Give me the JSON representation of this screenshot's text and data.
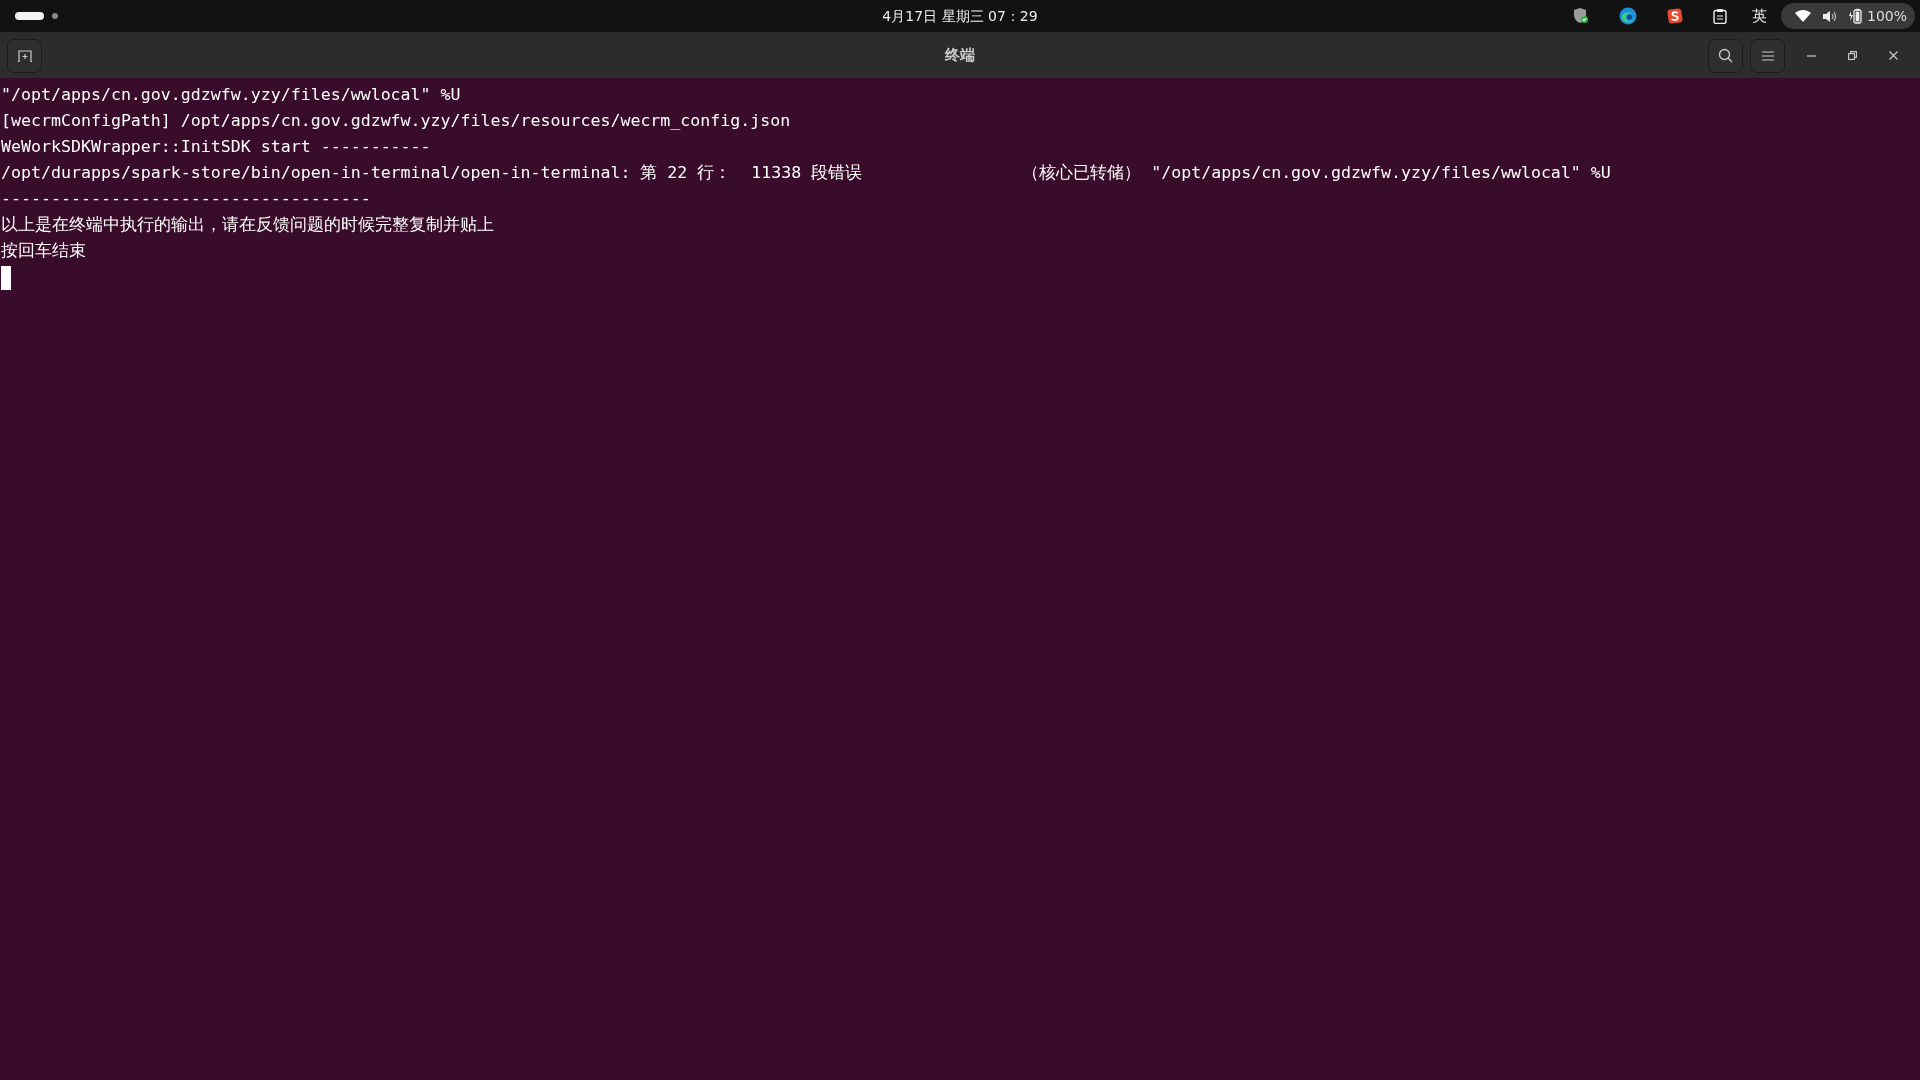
{
  "top_bar": {
    "clock": "4月17日 星期三 07：29",
    "input_method": "英",
    "battery": "100%"
  },
  "window": {
    "title": "终端"
  },
  "terminal": {
    "lines": [
      {
        "text": "\"/opt/apps/cn.gov.gdzwfw.yzy/files/wwlocal\" %U"
      },
      {
        "text": "[wecrmConfigPath] /opt/apps/cn.gov.gdzwfw.yzy/files/resources/wecrm_config.json"
      },
      {
        "text": "WeWorkSDKWrapper::InitSDK start -----------"
      },
      {
        "text": "/opt/durapps/spark-store/bin/open-in-terminal/open-in-terminal: 第 22 行：  11338 段错误",
        "tail": "（核心已转储） \"/opt/apps/cn.gov.gdzwfw.yzy/files/wwlocal\" %U"
      },
      {
        "text": "-------------------------------------"
      },
      {
        "text": "以上是在终端中执行的输出，请在反馈问题的时候完整复制并贴上"
      },
      {
        "text": "按回车结束"
      }
    ],
    "cursor": true
  }
}
